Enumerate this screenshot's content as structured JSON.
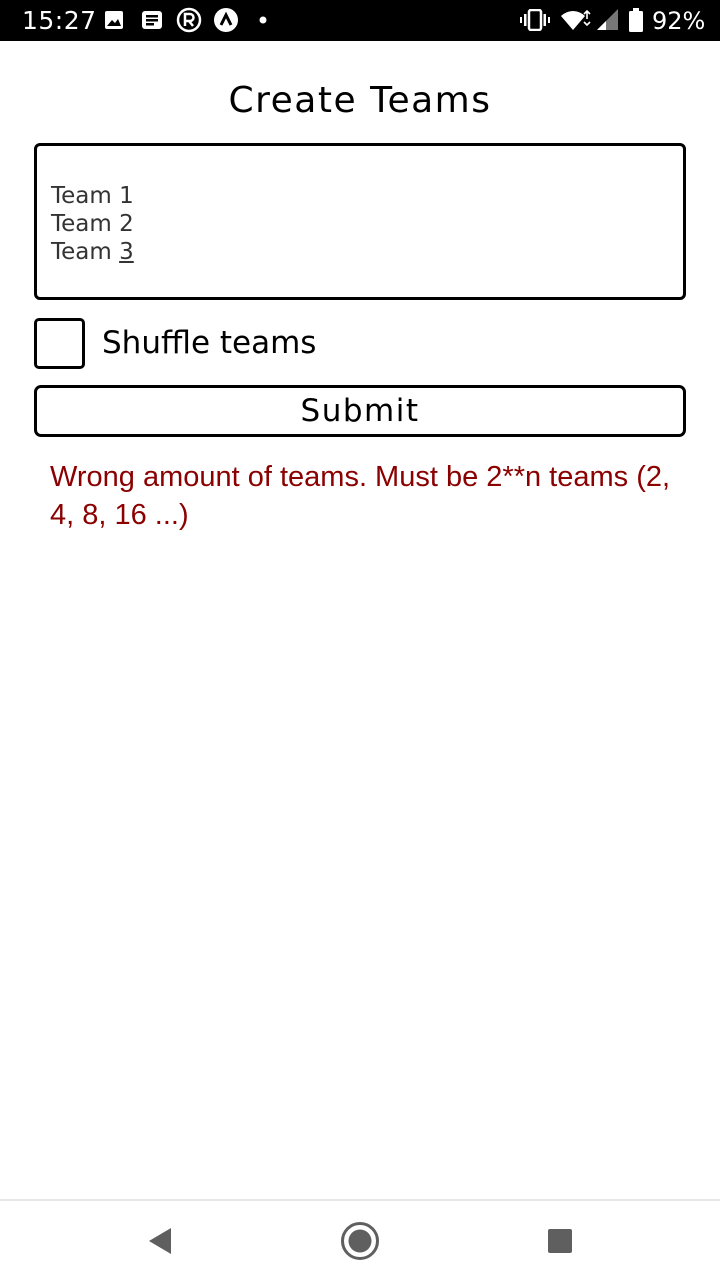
{
  "status_bar": {
    "time": "15:27",
    "battery": "92%",
    "icons": [
      "image-icon",
      "news-icon",
      "r-icon",
      "a-icon",
      "dot-icon",
      "vibrate-icon",
      "wifi-icon",
      "signal-icon",
      "battery-icon"
    ]
  },
  "page": {
    "title": "Create Teams"
  },
  "teams_input": {
    "lines": [
      "Team 1",
      "Team 2",
      "Team "
    ],
    "last_suffix": "3"
  },
  "shuffle": {
    "label": "Shuffle teams",
    "checked": false
  },
  "submit": {
    "label": "Submit"
  },
  "error": {
    "message": "Wrong amount of teams. Must be 2**n teams (2, 4, 8, 16 ...)",
    "color": "#8b0000"
  },
  "nav": {
    "buttons": [
      "back-icon",
      "home-icon",
      "recents-icon"
    ]
  }
}
